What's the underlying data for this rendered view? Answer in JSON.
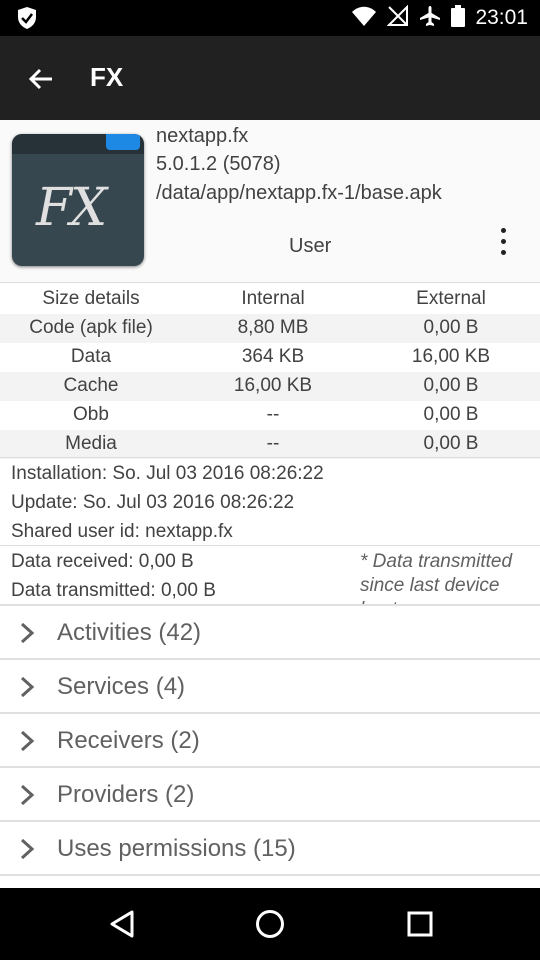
{
  "status_bar": {
    "time": "23:01"
  },
  "app_bar": {
    "title": "FX"
  },
  "app_info": {
    "icon_text": "FX",
    "package": "nextapp.fx",
    "version": "5.0.1.2 (5078)",
    "path": "/data/app/nextapp.fx-1/base.apk",
    "type": "User"
  },
  "size_table": {
    "headers": [
      "Size details",
      "Internal",
      "External"
    ],
    "rows": [
      [
        "Code (apk file)",
        "8,80 MB",
        "0,00 B"
      ],
      [
        "Data",
        "364 KB",
        "16,00 KB"
      ],
      [
        "Cache",
        "16,00 KB",
        "0,00 B"
      ],
      [
        "Obb",
        "--",
        "0,00 B"
      ],
      [
        "Media",
        "--",
        "0,00 B"
      ]
    ]
  },
  "details": {
    "installation": "Installation: So. Jul 03 2016 08:26:22",
    "update": "Update: So. Jul 03 2016 08:26:22",
    "shared_user": "Shared user id: nextapp.fx"
  },
  "traffic": {
    "received": "Data received: 0,00 B",
    "transmitted": "Data transmitted: 0,00 B",
    "note": "* Data transmitted since last device boot"
  },
  "sections": [
    {
      "label": "Activities (42)"
    },
    {
      "label": "Services (4)"
    },
    {
      "label": "Receivers (2)"
    },
    {
      "label": "Providers (2)"
    },
    {
      "label": "Uses permissions (15)"
    }
  ],
  "colors": {
    "status_bar": "#000000",
    "app_bar": "#212121",
    "icon_bg": "#37474f",
    "icon_accent": "#1e88e5"
  }
}
